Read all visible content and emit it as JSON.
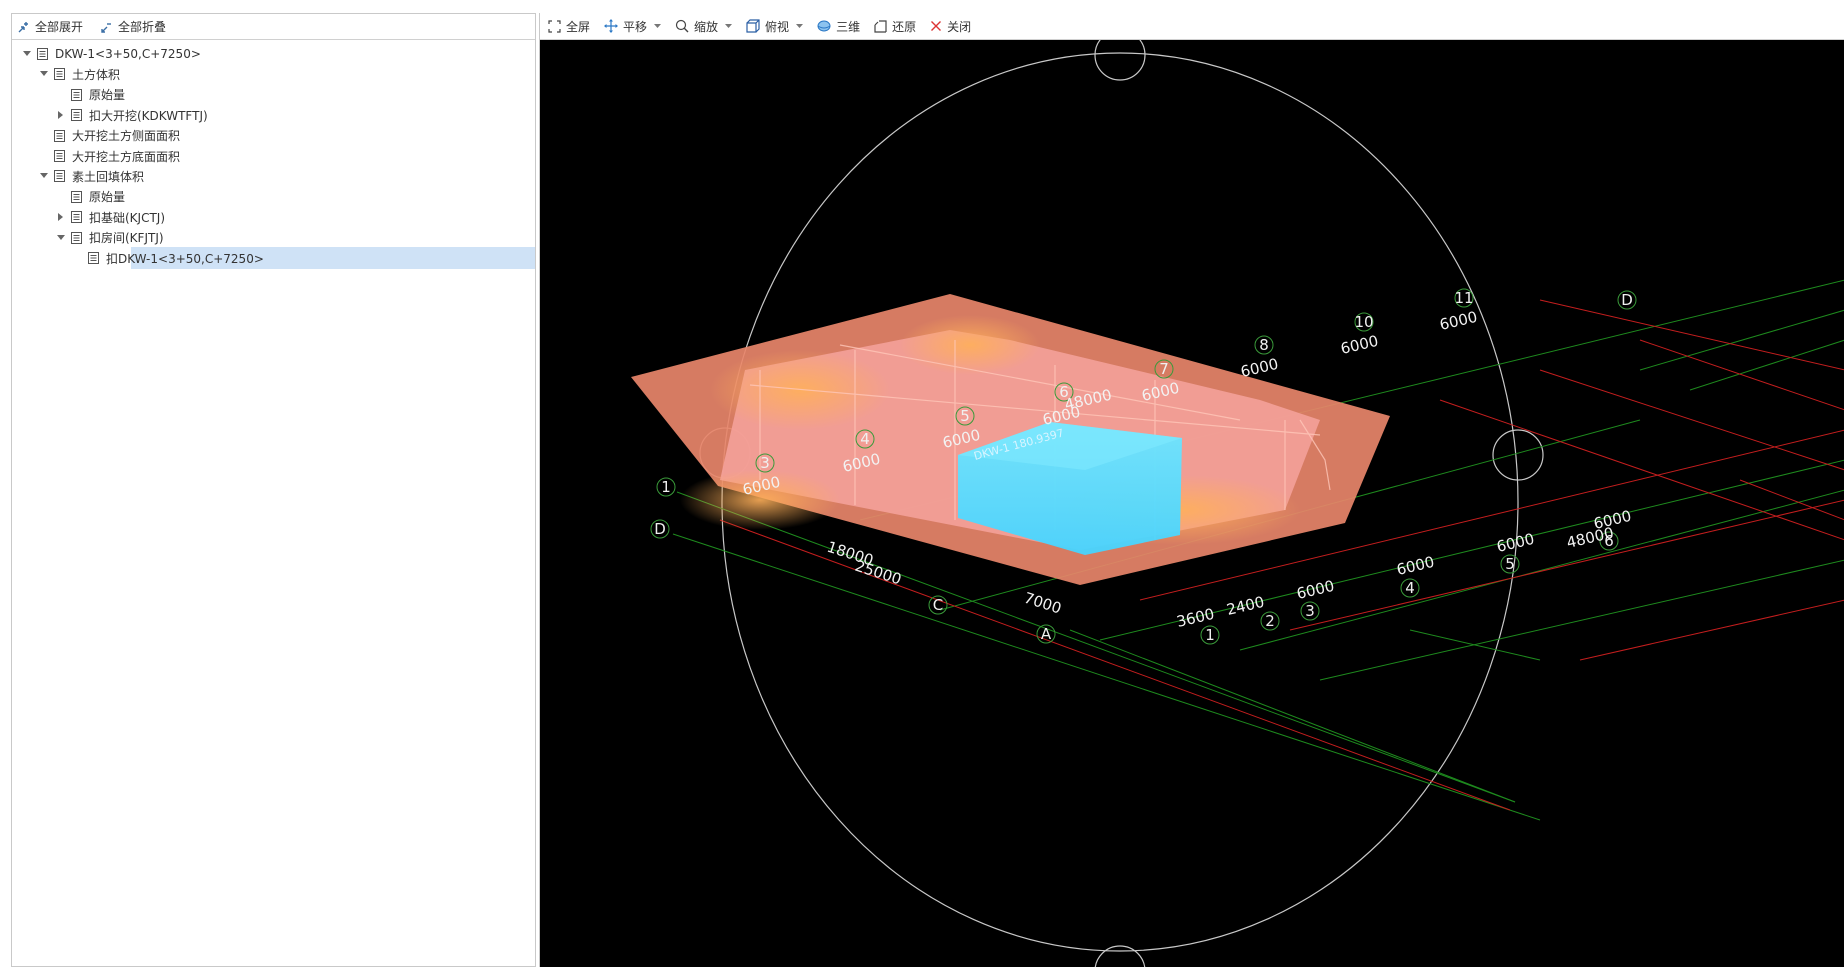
{
  "left_toolbar": {
    "expand_all": "全部展开",
    "collapse_all": "全部折叠"
  },
  "tree": [
    {
      "label": "DKW-1<3+50,C+7250>",
      "level": 0,
      "arrow": "down"
    },
    {
      "label": "土方体积",
      "level": 1,
      "arrow": "down"
    },
    {
      "label": "原始量",
      "level": 2,
      "arrow": "none"
    },
    {
      "label": "扣大开挖(KDKWTFTJ)",
      "level": 2,
      "arrow": "right"
    },
    {
      "label": "大开挖土方侧面面积",
      "level": 1,
      "arrow": "none"
    },
    {
      "label": "大开挖土方底面面积",
      "level": 1,
      "arrow": "none"
    },
    {
      "label": "素土回填体积",
      "level": 1,
      "arrow": "down"
    },
    {
      "label": "原始量",
      "level": 2,
      "arrow": "none"
    },
    {
      "label": "扣基础(KJCTJ)",
      "level": 2,
      "arrow": "right"
    },
    {
      "label": "扣房间(KFJTJ)",
      "level": 2,
      "arrow": "down"
    },
    {
      "label": "扣DKW-1<3+50,C+7250>",
      "level": 3,
      "arrow": "none",
      "selected": true
    }
  ],
  "right_toolbar": {
    "fullscreen": "全屏",
    "pan": "平移",
    "zoom": "缩放",
    "top_view": "俯视",
    "three_d": "三维",
    "restore": "还原",
    "close": "关闭"
  },
  "scene": {
    "object_label": "DKW-1 180.9397",
    "axis_markers": {
      "m3": "3",
      "m4": "4",
      "m5": "5",
      "m6": "6",
      "m7": "7",
      "m8": "8",
      "m10": "10",
      "m11": "11",
      "m1_left": "1",
      "mD_left": "D",
      "mC": "C",
      "mA": "A",
      "mD_right": "D",
      "m1_bottom": "1",
      "m2_bottom": "2",
      "m3_bottom": "3",
      "m4_bottom": "4",
      "m5_bottom": "5",
      "m6_right": "6"
    },
    "dimensions": {
      "d_6000_a": "6000",
      "d_6000_b": "6000",
      "d_6000_c": "6000",
      "d_6000_d": "6000",
      "d_48000_top": "48000",
      "d_6000_e": "6000",
      "d_6000_f": "6000",
      "d_6000_g": "6000",
      "d_6000_h": "6000",
      "d_18000": "18000",
      "d_25000": "25000",
      "d_7000": "7000",
      "d_3600": "3600",
      "d_2400": "2400",
      "d_6000_i": "6000",
      "d_6000_j": "6000",
      "d_6000_k": "6000",
      "d_48000_right": "48000",
      "d_6000_l": "6000"
    }
  }
}
